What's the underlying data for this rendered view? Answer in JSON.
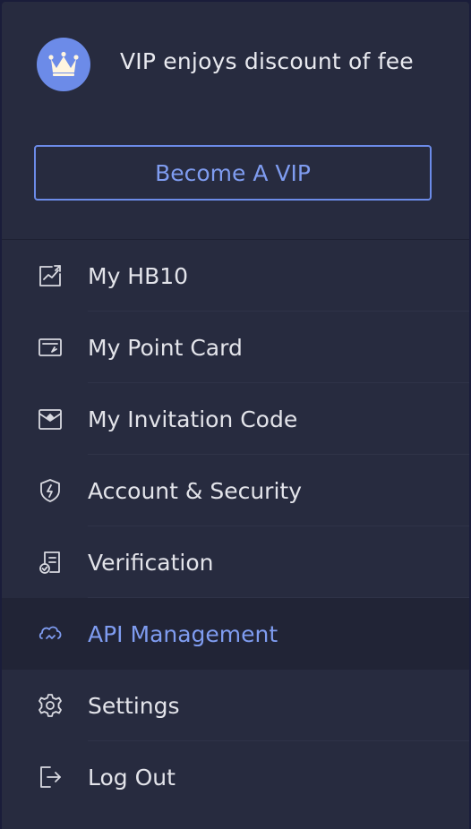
{
  "vip": {
    "badge_icon": "crown-icon",
    "description": "VIP enjoys discount of fee",
    "button_label": "Become A VIP"
  },
  "menu": {
    "items": [
      {
        "label": "My HB10",
        "icon": "chart-icon"
      },
      {
        "label": "My Point Card",
        "icon": "point-card-icon"
      },
      {
        "label": "My Invitation Code",
        "icon": "invitation-icon"
      },
      {
        "label": "Account & Security",
        "icon": "shield-icon"
      },
      {
        "label": "Verification",
        "icon": "verification-icon"
      },
      {
        "label": "API Management",
        "icon": "api-icon",
        "active": true
      },
      {
        "label": "Settings",
        "icon": "gear-icon"
      },
      {
        "label": "Log Out",
        "icon": "logout-icon"
      }
    ]
  },
  "colors": {
    "accent": "#6c8be8",
    "panel_bg": "#272b3f",
    "active_row_bg": "#212436",
    "text": "#e3e4ea"
  }
}
